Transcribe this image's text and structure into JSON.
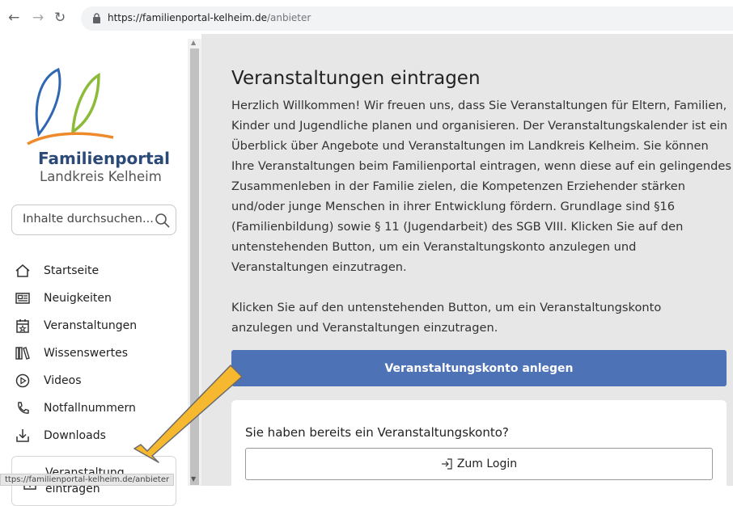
{
  "browser": {
    "url_host": "https://familienportal-kelheim.de",
    "url_path": "/anbieter"
  },
  "sidebar": {
    "logo_title": "Familienportal",
    "logo_subtitle": "Landkreis Kelheim",
    "search_placeholder": "Inhalte durchsuchen...",
    "items": [
      {
        "label": "Startseite",
        "icon": "home-icon"
      },
      {
        "label": "Neuigkeiten",
        "icon": "newspaper-icon"
      },
      {
        "label": "Veranstaltungen",
        "icon": "calendar-icon"
      },
      {
        "label": "Wissenswertes",
        "icon": "books-icon"
      },
      {
        "label": "Videos",
        "icon": "play-icon"
      },
      {
        "label": "Notfallnummern",
        "icon": "phone-icon"
      },
      {
        "label": "Downloads",
        "icon": "download-icon"
      }
    ],
    "cta_label": "Veranstaltung eintragen"
  },
  "status_url": "ttps://familienportal-kelheim.de/anbieter",
  "main": {
    "title": "Veranstaltungen eintragen",
    "intro": "Herzlich Willkommen! Wir freuen uns, dass Sie Veranstaltungen für Eltern, Familien, Kinder und Jugendliche planen und organisieren. Der Veranstaltungskalender ist ein Überblick über Angebote und Veranstaltungen im Landkreis Kelheim. Sie können Ihre Veranstaltungen beim Familienportal eintragen, wenn diese auf ein gelingendes Zusammenleben in der Familie zielen, die Kompetenzen Erziehender stärken und/oder junge Menschen in ihrer Entwicklung fördern. Grundlage sind §16 (Familienbildung) sowie § 11 (Jugendarbeit) des SGB VIII. Klicken Sie auf den untenstehenden Button, um ein Veranstaltungskonto anzulegen und Veranstaltungen einzutragen.",
    "instruction": "Klicken Sie auf den untenstehenden Button, um ein Veranstaltungskonto anzulegen und Veranstaltungen einzutragen.",
    "create_button": "Veranstaltungskonto anlegen",
    "login_prompt": "Sie haben bereits ein Veranstaltungskonto?",
    "login_button": "Zum Login"
  },
  "colors": {
    "primary": "#4d73b6",
    "arrow": "#f5b82e",
    "logo_navy": "#2b4a77"
  }
}
